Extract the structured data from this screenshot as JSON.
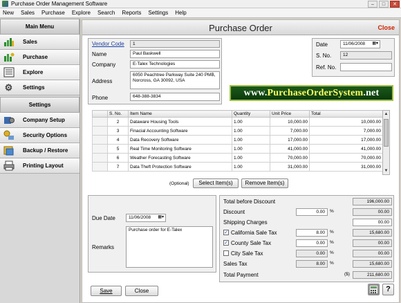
{
  "window": {
    "title": "Purchase Order Management Software"
  },
  "menu": [
    "New",
    "Sales",
    "Purchase",
    "Explore",
    "Search",
    "Reports",
    "Settings",
    "Help"
  ],
  "sidebar": {
    "main_header": "Main Menu",
    "main_items": [
      {
        "label": "Sales",
        "icon": "sales-chart-icon"
      },
      {
        "label": "Purchase",
        "icon": "purchase-chart-icon"
      },
      {
        "label": "Explore",
        "icon": "explore-icon"
      },
      {
        "label": "Settings",
        "icon": "gear-icon"
      }
    ],
    "settings_header": "Settings",
    "settings_items": [
      {
        "label": "Company Setup",
        "icon": "company-setup-icon"
      },
      {
        "label": "Security Options",
        "icon": "lock-key-icon"
      },
      {
        "label": "Backup / Restore",
        "icon": "backup-icon"
      },
      {
        "label": "Printing Layout",
        "icon": "printer-icon"
      }
    ]
  },
  "form": {
    "title": "Purchase Order",
    "close_label": "Close",
    "vendor": {
      "vendor_code_label": "Vendor Code",
      "vendor_code": "1",
      "name_label": "Name",
      "name": "Paul Baskwell",
      "company_label": "Company",
      "company": "E-Talex Technologies",
      "address_label": "Address",
      "address": "6050 Peachtree Parkway Suite 240 PMB,\nNorcross, GA 30092, USA",
      "phone_label": "Phone",
      "phone": "648-388-3834"
    },
    "meta": {
      "date_label": "Date",
      "date": "11/06/2008",
      "sno_label": "S. No.",
      "sno": "12",
      "ref_label": "Ref. No.",
      "ref": ""
    },
    "banner": {
      "prefix": "www.",
      "highlight": "PurchaseOrderSystem",
      "suffix": ".net"
    },
    "items_table": {
      "columns": [
        "S. No.",
        "Item Name",
        "Quantity",
        "Unit Price",
        "Total"
      ],
      "rows": [
        [
          "2",
          "Dataware Housing Tools",
          "1.00",
          "10,000.00",
          "10,000.00"
        ],
        [
          "3",
          "Finacial Accounting Software",
          "1.00",
          "7,000.00",
          "7,000.00"
        ],
        [
          "4",
          "Data Recovery Software",
          "1.00",
          "17,000.00",
          "17,000.00"
        ],
        [
          "5",
          "Real Time Monitoring Software",
          "1.00",
          "41,000.00",
          "41,000.00"
        ],
        [
          "6",
          "Weather Forecasting Software",
          "1.00",
          "70,000.00",
          "70,000.00"
        ],
        [
          "7",
          "Data Theft Protection Software",
          "1.00",
          "31,000.00",
          "31,000.00"
        ]
      ]
    },
    "item_actions": {
      "optional_label": "(Optional)",
      "select_label": "Select Item(s)",
      "remove_label": "Remove Item(s)"
    },
    "due_date_label": "Due Date",
    "due_date": "11/06/2008",
    "remarks_label": "Remarks",
    "remarks": "Purchase order for E-Talex",
    "summary": {
      "total_before_discount_label": "Total before Discount",
      "total_before_discount": "196,000.00",
      "discount_label": "Discount",
      "discount_pct": "0.00",
      "discount_amount": "00.00",
      "shipping_label": "Shipping Charges",
      "shipping": "00.00",
      "california_label": "California Sale Tax",
      "california_checked": true,
      "california_pct": "8.00",
      "california_amount": "15,680.00",
      "county_label": "County Sale Tax",
      "county_checked": true,
      "county_pct": "0.00",
      "county_amount": "00.00",
      "city_label": "City Sale Tax",
      "city_checked": false,
      "city_pct": "0.00",
      "city_amount": "00.00",
      "sales_tax_label": "Sales Tax",
      "sales_tax_pct": "8.00",
      "sales_tax_amount": "15,680.00",
      "total_payment_label": "Total Payment",
      "currency": "($)",
      "total_payment": "211,680.00",
      "pct_sign": "%"
    },
    "footer": {
      "save_label": "Save",
      "close_label": "Close"
    }
  }
}
